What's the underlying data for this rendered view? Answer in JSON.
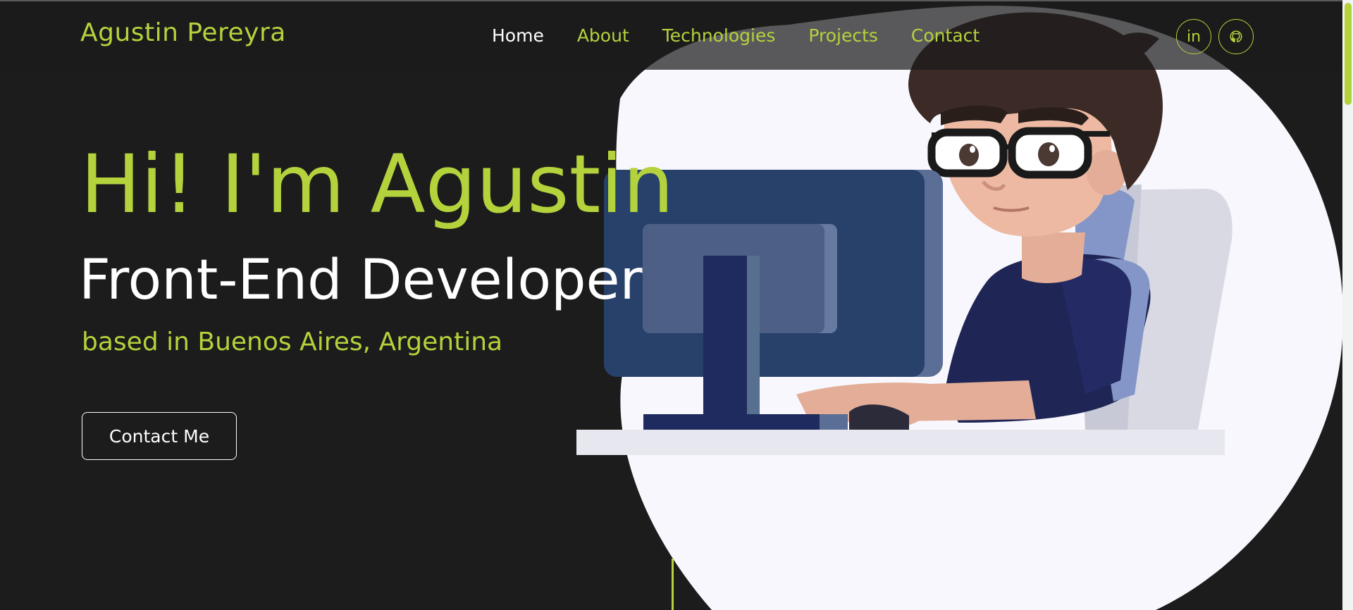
{
  "header": {
    "brand": "Agustin Pereyra",
    "nav": [
      {
        "label": "Home",
        "active": true
      },
      {
        "label": "About",
        "active": false
      },
      {
        "label": "Technologies",
        "active": false
      },
      {
        "label": "Projects",
        "active": false
      },
      {
        "label": "Contact",
        "active": false
      }
    ],
    "socials": [
      {
        "label": "in",
        "icon": "linkedin-icon"
      },
      {
        "label": "",
        "icon": "github-icon"
      }
    ]
  },
  "hero": {
    "greeting": "Hi! I'm Agustin",
    "role": "Front-End Developer",
    "location": "based in Buenos Aires, Argentina",
    "cta_label": "Contact Me"
  },
  "colors": {
    "background": "#1c1c1c",
    "accent": "#b4d23c",
    "text": "#ffffff",
    "blob": "#f7f7fd"
  }
}
